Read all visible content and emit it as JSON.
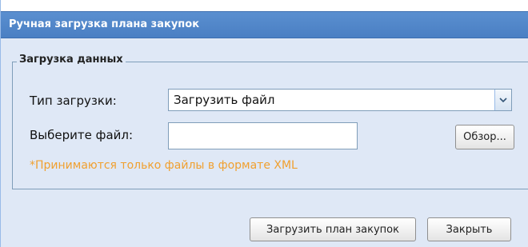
{
  "window": {
    "title": "Ручная загрузка плана закупок"
  },
  "section": {
    "legend": "Загрузка данных"
  },
  "form": {
    "load_type_label": "Тип загрузки:",
    "load_type_value": "Загрузить файл",
    "file_label": "Выберите файл:",
    "file_value": "",
    "browse_label": "Обзор...",
    "hint": "*Принимаются только файлы в формате XML"
  },
  "footer": {
    "upload_label": "Загрузить план закупок",
    "close_label": "Закрыть"
  },
  "colors": {
    "title_bar": "#4a7fc3",
    "panel": "#dfe8f6",
    "hint": "#f0a030"
  },
  "icons": {
    "combo_trigger": "chevron-down-icon"
  }
}
